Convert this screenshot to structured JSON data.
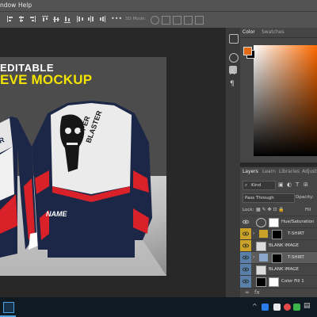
{
  "menu": {
    "items": [
      "ndow",
      "Help"
    ]
  },
  "options": {
    "mode_3d": "3D Mode:"
  },
  "canvas": {
    "title_line1": "EDITABLE",
    "title_line2": "EVE MOCKUP",
    "shirt_text_brand": "HYPER BLASTER",
    "shirt_text_name": "NAME"
  },
  "color_panel": {
    "tab_color": "Color",
    "tab_swatches": "Swatches",
    "fg_color": "#e06a16",
    "bg_color": "#000000"
  },
  "layers_panel": {
    "tabs": [
      "Layers",
      "Learn",
      "Libraries",
      "Adjust"
    ],
    "filter_label": "Kind",
    "blend_mode": "Pass Through",
    "opacity_label": "Opacity:",
    "lock_label": "Lock:",
    "fill_label": "Fill",
    "layers": [
      {
        "name": "Hue/Saturation",
        "type": "adjustment"
      },
      {
        "name": "T-SHIRT",
        "type": "group"
      },
      {
        "name": "BLANK IMAGE",
        "type": "smart"
      },
      {
        "name": "T-SHIRT",
        "type": "group"
      },
      {
        "name": "BLANK IMAGE",
        "type": "smart"
      },
      {
        "name": "Color Fill 1",
        "type": "fill"
      }
    ]
  },
  "colors": {
    "accent": "#f4e400",
    "panel": "#454545",
    "shirt_navy": "#1c2747",
    "shirt_red": "#d82128"
  }
}
